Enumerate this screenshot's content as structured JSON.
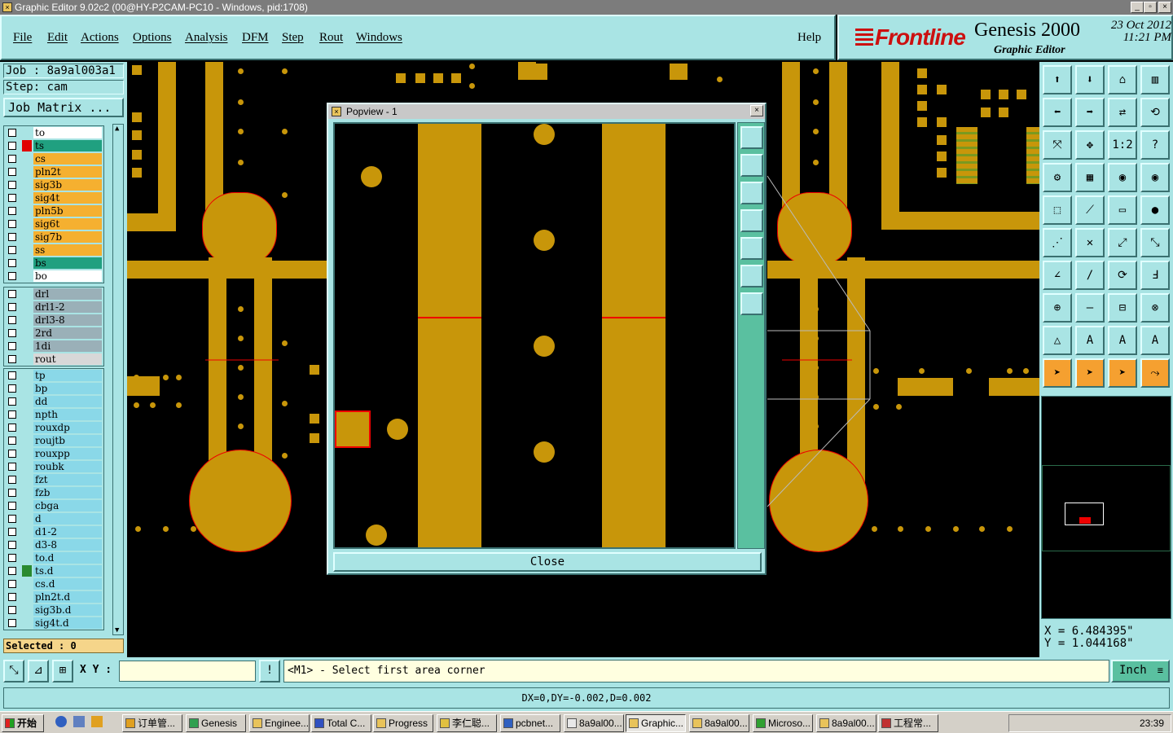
{
  "window": {
    "title": "Graphic Editor 9.02c2 (00@HY-P2CAM-PC10 - Windows, pid:1708)",
    "controls": [
      "_",
      "▫",
      "×"
    ]
  },
  "menu": [
    "File",
    "Edit",
    "Actions",
    "Options",
    "Analysis",
    "DFM",
    "Step",
    "Rout",
    "Windows",
    "Help"
  ],
  "branding": {
    "company": "Frontline",
    "product": "Genesis 2000",
    "subtitle": "Graphic Editor",
    "date": "23 Oct 2012",
    "time": "11:21 PM"
  },
  "job": {
    "job_label": "Job : 8a9al003a1",
    "step_label": "Step: cam",
    "matrix_button": "Job Matrix ..."
  },
  "layers": {
    "board": [
      {
        "name": "to",
        "color": "#ffffff",
        "marker": ""
      },
      {
        "name": "ts",
        "color": "#20a080",
        "marker": "#e00000"
      },
      {
        "name": "cs",
        "color": "#f5b030",
        "marker": ""
      },
      {
        "name": "pln2t",
        "color": "#f5b030",
        "marker": ""
      },
      {
        "name": "sig3b",
        "color": "#f5b030",
        "marker": ""
      },
      {
        "name": "sig4t",
        "color": "#f5b030",
        "marker": ""
      },
      {
        "name": "pln5b",
        "color": "#f5b030",
        "marker": ""
      },
      {
        "name": "sig6t",
        "color": "#f5b030",
        "marker": ""
      },
      {
        "name": "sig7b",
        "color": "#f5b030",
        "marker": ""
      },
      {
        "name": "ss",
        "color": "#f5b030",
        "marker": ""
      },
      {
        "name": "bs",
        "color": "#20a080",
        "marker": ""
      },
      {
        "name": "bo",
        "color": "#ffffff",
        "marker": ""
      }
    ],
    "drill": [
      {
        "name": "drl",
        "color": "#9ab0b8",
        "marker": ""
      },
      {
        "name": "drl1-2",
        "color": "#9ab0b8",
        "marker": ""
      },
      {
        "name": "drl3-8",
        "color": "#9ab0b8",
        "marker": ""
      },
      {
        "name": "2rd",
        "color": "#9ab0b8",
        "marker": ""
      },
      {
        "name": "1di",
        "color": "#9ab0b8",
        "marker": ""
      },
      {
        "name": "rout",
        "color": "#d8d8d8",
        "marker": ""
      }
    ],
    "misc": [
      {
        "name": "tp",
        "color": "#8ad8e8",
        "marker": ""
      },
      {
        "name": "bp",
        "color": "#8ad8e8",
        "marker": ""
      },
      {
        "name": "dd",
        "color": "#8ad8e8",
        "marker": ""
      },
      {
        "name": "npth",
        "color": "#8ad8e8",
        "marker": ""
      },
      {
        "name": "rouxdp",
        "color": "#8ad8e8",
        "marker": ""
      },
      {
        "name": "roujtb",
        "color": "#8ad8e8",
        "marker": ""
      },
      {
        "name": "rouxpp",
        "color": "#8ad8e8",
        "marker": ""
      },
      {
        "name": "roubk",
        "color": "#8ad8e8",
        "marker": ""
      },
      {
        "name": "fzt",
        "color": "#8ad8e8",
        "marker": ""
      },
      {
        "name": "fzb",
        "color": "#8ad8e8",
        "marker": ""
      },
      {
        "name": "cbga",
        "color": "#8ad8e8",
        "marker": ""
      },
      {
        "name": "d",
        "color": "#8ad8e8",
        "marker": ""
      },
      {
        "name": "d1-2",
        "color": "#8ad8e8",
        "marker": ""
      },
      {
        "name": "d3-8",
        "color": "#8ad8e8",
        "marker": ""
      },
      {
        "name": "to.d",
        "color": "#8ad8e8",
        "marker": ""
      },
      {
        "name": "ts.d",
        "color": "#8ad8e8",
        "marker": "#2a8a30"
      },
      {
        "name": "cs.d",
        "color": "#8ad8e8",
        "marker": ""
      },
      {
        "name": "pln2t.d",
        "color": "#8ad8e8",
        "marker": ""
      },
      {
        "name": "sig3b.d",
        "color": "#8ad8e8",
        "marker": ""
      },
      {
        "name": "sig4t.d",
        "color": "#8ad8e8",
        "marker": ""
      }
    ]
  },
  "selected_label": "Selected : 0",
  "popview": {
    "title": "Popview - 1",
    "close_label": "Close"
  },
  "command": {
    "xy_label": "X Y :",
    "xy_value": "",
    "prompt": "<M1> - Select first area corner",
    "unit": "Inch"
  },
  "coords": {
    "x": "X = 6.484395\"",
    "y": "Y = 1.044168\""
  },
  "status": "DX=0,DY=-0.002,D=0.002",
  "taskbar": {
    "start": "开始",
    "tasks": [
      "订单管...",
      "Genesis",
      "Enginee...",
      "Total C...",
      "Progress",
      "李仁聪...",
      "pcbnet...",
      "8a9al00...",
      "Graphic...",
      "8a9al00...",
      "Microso...",
      "8a9al00...",
      "工程常..."
    ],
    "active_task": "Graphic...",
    "clock": "23:39"
  },
  "colors": {
    "copper": "#c8960a",
    "panel": "#a9e4e4",
    "highlight": "#e00000"
  }
}
